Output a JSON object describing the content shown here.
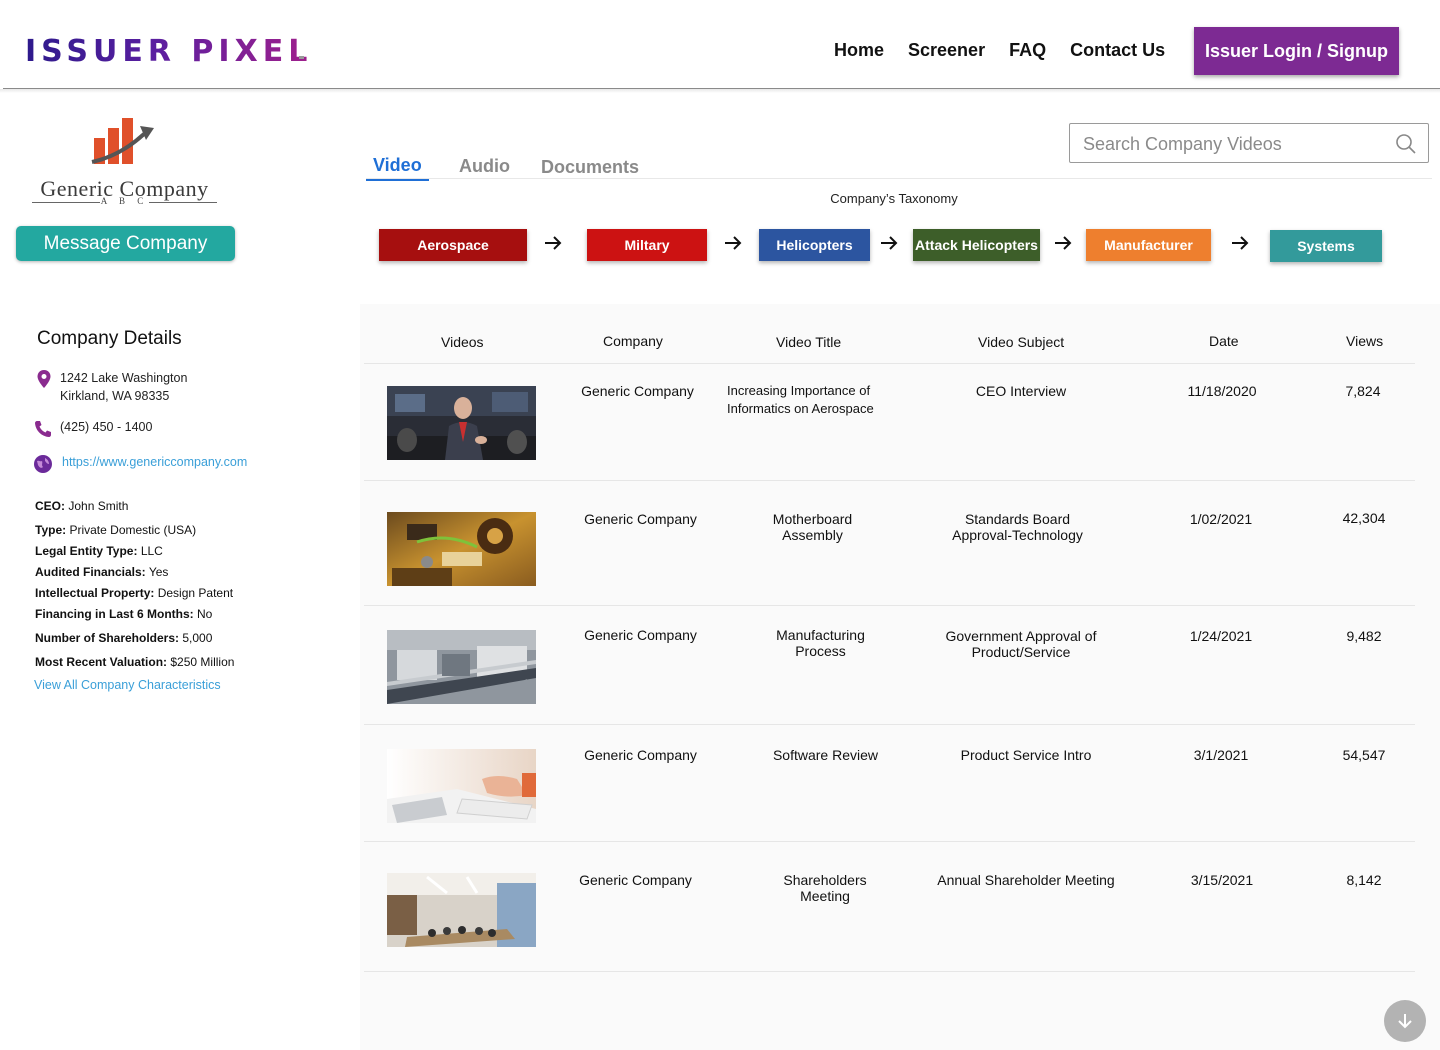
{
  "header": {
    "logo_text": "ISSUER PIXEL",
    "nav": [
      "Home",
      "Screener",
      "FAQ",
      "Contact Us"
    ],
    "login_label": "Issuer Login / Signup"
  },
  "company": {
    "name": "Generic Company",
    "name_sub": "A B C",
    "message_label": "Message Company"
  },
  "tabs": [
    "Video",
    "Audio",
    "Documents"
  ],
  "search": {
    "placeholder": "Search Company Videos"
  },
  "taxonomy": {
    "title": "Company’s Taxonomy",
    "items": [
      {
        "label": "Aerospace",
        "color": "#a60f0f"
      },
      {
        "label": "Miltary",
        "color": "#cc1212"
      },
      {
        "label": "Helicopters",
        "color": "#2c55a0"
      },
      {
        "label": "Attack Helicopters",
        "color": "#3d5e29"
      },
      {
        "label": "Manufacturer",
        "color": "#ee7f2e"
      },
      {
        "label": "Systems",
        "color": "#339a9b"
      }
    ]
  },
  "details": {
    "title": "Company Details",
    "address_line1": "1242 Lake Washington",
    "address_line2": "Kirkland, WA 98335",
    "phone": "(425) 450 - 1400",
    "website": "https://www.genericcompany.com",
    "fields": [
      {
        "key": "CEO:",
        "value": "John Smith"
      },
      {
        "key": "Type:",
        "value": "Private Domestic (USA)"
      },
      {
        "key": "Legal Entity Type:",
        "value": "LLC"
      },
      {
        "key": "Audited Financials:",
        "value": "Yes"
      },
      {
        "key": "Intellectual Property:",
        "value": "Design Patent"
      },
      {
        "key": "Financing in Last 6 Months:",
        "value": "No"
      },
      {
        "key": "Number of Shareholders:",
        "value": "5,000"
      },
      {
        "key": "Most Recent Valuation:",
        "value": "$250 Million"
      }
    ],
    "view_all": "View All Company Characteristics"
  },
  "table": {
    "headers": [
      "Videos",
      "Company",
      "Video Title",
      "Video Subject",
      "Date",
      "Views"
    ],
    "rows": [
      {
        "company": "Generic Company",
        "title": "Increasing Importance of Informatics on Aerospace",
        "subject": "CEO Interview",
        "date": "11/18/2020",
        "views": "7,824"
      },
      {
        "company": "Generic Company",
        "title": "Motherboard Assembly",
        "subject": "Standards Board Approval-Technology",
        "date": "1/02/2021",
        "views": "42,304"
      },
      {
        "company": "Generic Company",
        "title": "Manufacturing Process",
        "subject": "Government Approval of Product/Service",
        "date": "1/24/2021",
        "views": "9,482"
      },
      {
        "company": "Generic Company",
        "title": "Software Review",
        "subject": "Product Service Intro",
        "date": "3/1/2021",
        "views": "54,547"
      },
      {
        "company": "Generic Company",
        "title": "Shareholders Meeting",
        "subject": "Annual Shareholder Meeting",
        "date": "3/15/2021",
        "views": "8,142"
      }
    ]
  }
}
